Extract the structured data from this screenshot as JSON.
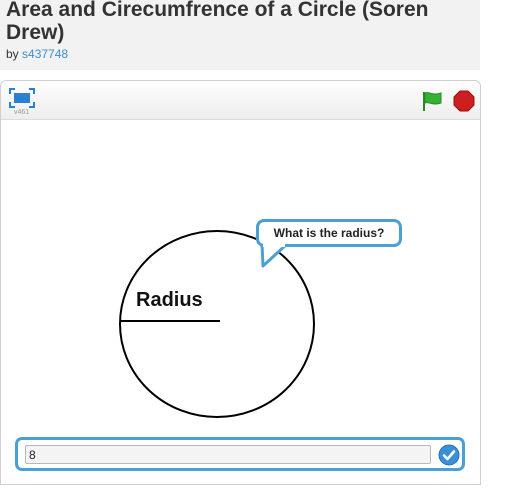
{
  "project": {
    "title": "Area and Cirecumfrence of a Circle (Soren Drew)",
    "by_label": "by",
    "author": "s437748"
  },
  "player": {
    "version": "v461",
    "icons": {
      "fullscreen": "fullscreen-icon",
      "flag": "green-flag-icon",
      "stop": "stop-sign-icon"
    },
    "colors": {
      "flag": "#33b233",
      "stop": "#cc1f1f",
      "accent": "#4a9fd5"
    }
  },
  "stage": {
    "speech_text": "What is the radius?",
    "radius_label": "Radius"
  },
  "answer": {
    "value": "8",
    "submit_icon": "checkmark-icon"
  }
}
